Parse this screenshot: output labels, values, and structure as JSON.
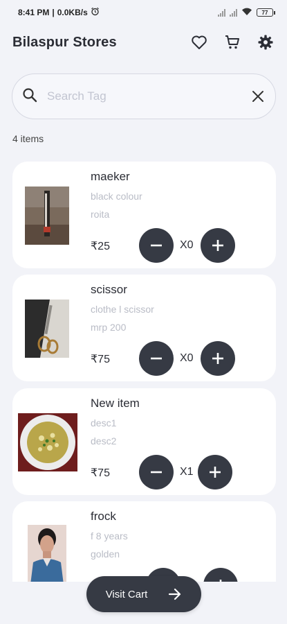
{
  "status_bar": {
    "time": "8:41 PM",
    "network_speed": "0.0KB/s",
    "battery": "77"
  },
  "app_bar": {
    "title": "Bilaspur Stores",
    "icons": [
      "heart-icon",
      "cart-icon",
      "gear-icon"
    ]
  },
  "search": {
    "placeholder": "Search Tag",
    "value": ""
  },
  "item_count": "4 items",
  "items": [
    {
      "name": "maeker",
      "desc1": "black colour",
      "desc2": "roita",
      "price": "₹25",
      "qty": "X0"
    },
    {
      "name": "scissor",
      "desc1": "clothe l scissor",
      "desc2": "mrp 200",
      "price": "₹75",
      "qty": "X0"
    },
    {
      "name": "New item",
      "desc1": "desc1",
      "desc2": "desc2",
      "price": "₹75",
      "qty": "X1"
    },
    {
      "name": "frock",
      "desc1": "f 8 years",
      "desc2": "golden",
      "price": "",
      "qty": ""
    }
  ],
  "cart_button": {
    "label": "Visit Cart"
  },
  "colors": {
    "background": "#f2f3f8",
    "card": "#ffffff",
    "accent_dark": "#363a44",
    "muted_text": "#b9bcc6"
  }
}
